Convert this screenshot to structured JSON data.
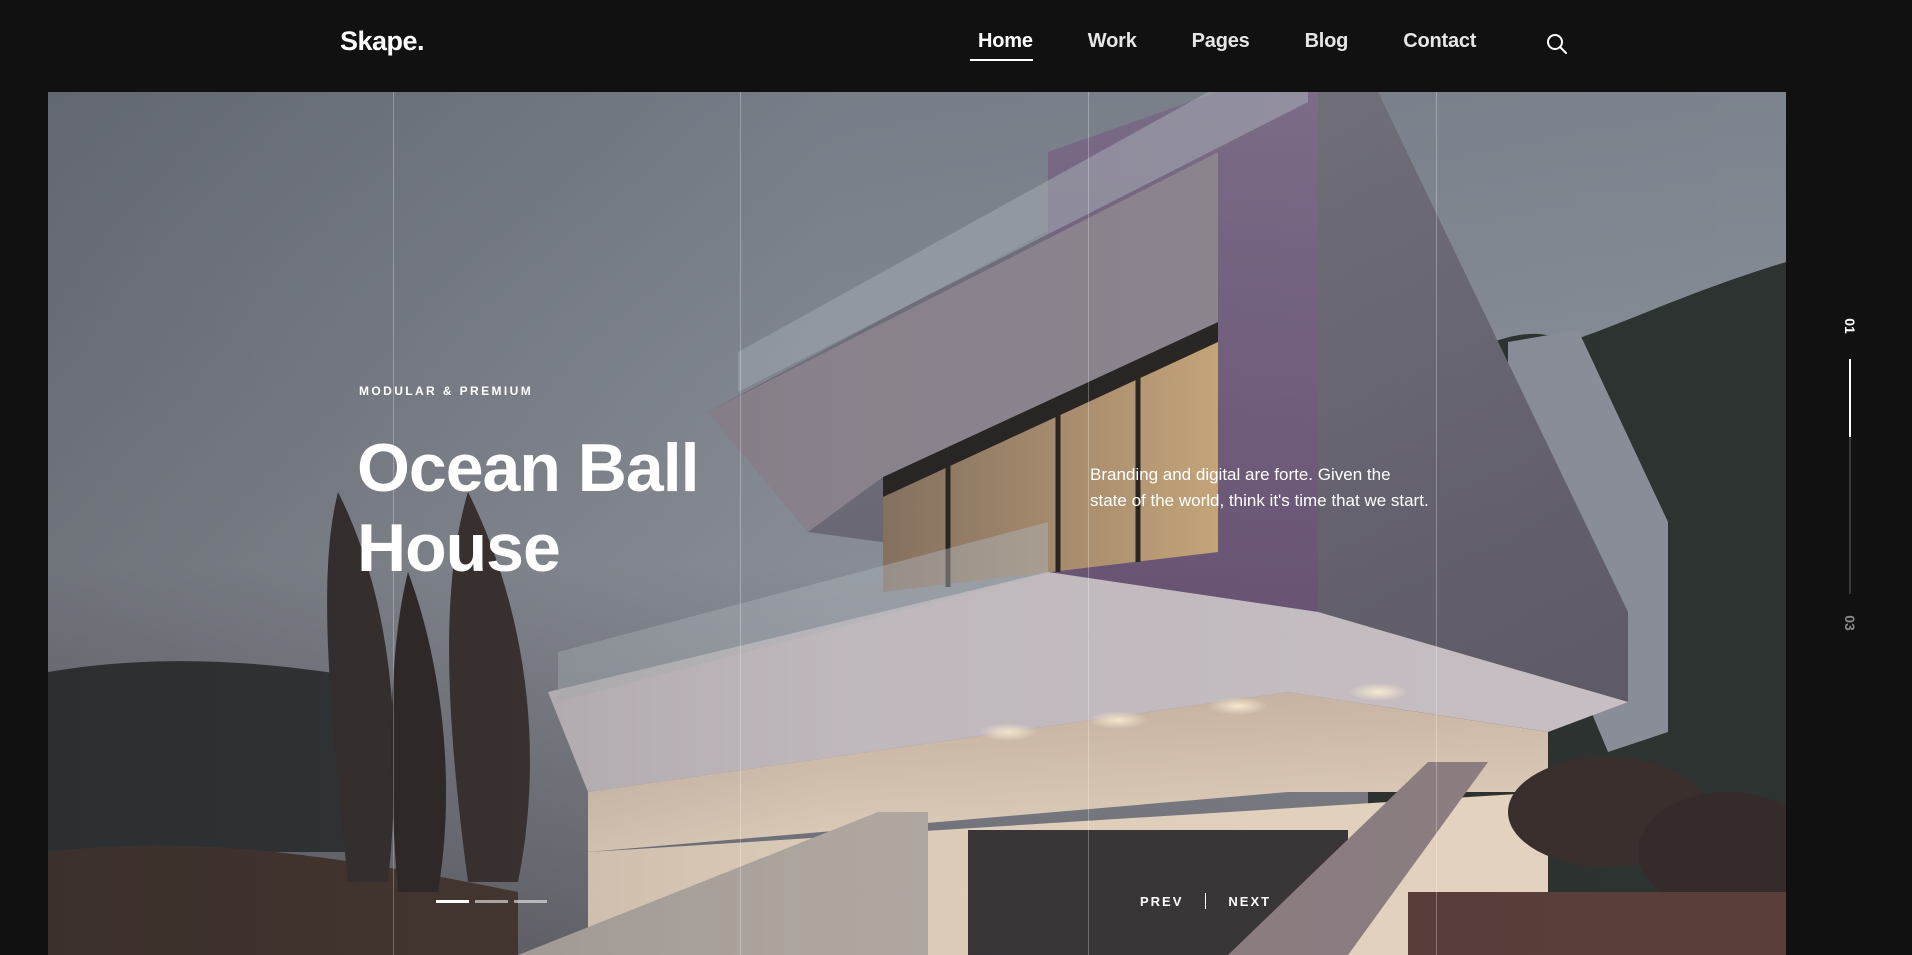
{
  "brand": {
    "logo": "Skape."
  },
  "nav": {
    "items": [
      {
        "label": "Home",
        "active": true
      },
      {
        "label": "Work",
        "active": false
      },
      {
        "label": "Pages",
        "active": false
      },
      {
        "label": "Blog",
        "active": false
      },
      {
        "label": "Contact",
        "active": false
      }
    ],
    "search_icon": "search-icon"
  },
  "hero": {
    "eyebrow": "MODULAR & PREMIUM",
    "title_line1": "Ocean Ball",
    "title_line2": "House",
    "description": "Branding and digital are forte. Given the state of the world, think it's time that we start.",
    "prev_label": "PREV",
    "next_label": "NEXT",
    "slide_count": 3,
    "active_slide": 1
  },
  "slide_indicator": {
    "current": "01",
    "total": "03"
  },
  "colors": {
    "background": "#111111",
    "text": "#ffffff",
    "muted": "#8a8a8a"
  }
}
